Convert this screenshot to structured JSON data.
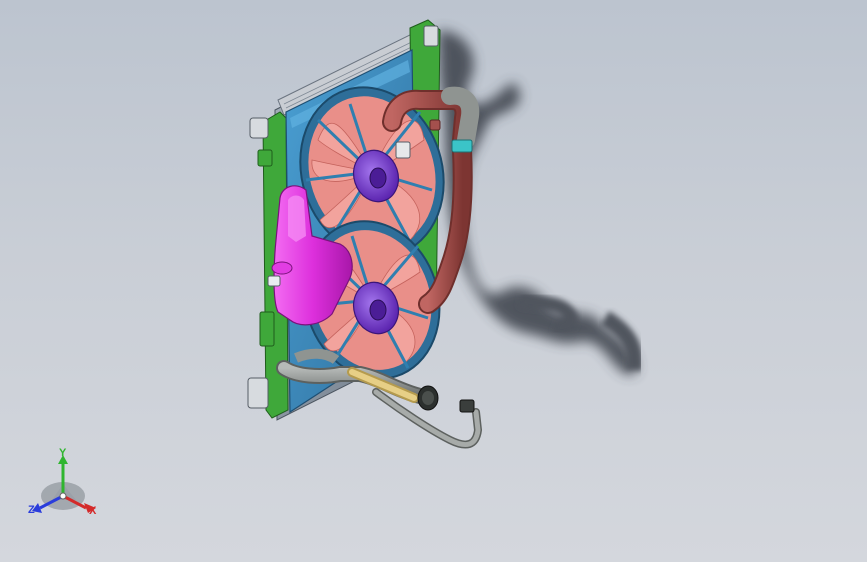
{
  "viewport": {
    "background_top": "#bcc4cf",
    "background_bottom": "#d4d7dd"
  },
  "model": {
    "colors": {
      "radiator_core": "#8d99a6",
      "fan_shroud": "#3f8fc4",
      "side_brackets": "#3fa83a",
      "fan_blades": "#f07e79",
      "fan_motor_hub": "#7b3fd6",
      "expansion_tank": "#e23de3",
      "upper_hose": "#a4504d",
      "lower_hose": "#8a8e8c",
      "hose_sleeve": "#e7cf86",
      "hose_clamp": "#3bc4c8",
      "shadow": "#333841"
    },
    "components": [
      "radiator-core",
      "fan-shroud",
      "upper-fan",
      "lower-fan",
      "expansion-tank",
      "upper-hose",
      "lower-hose",
      "side-brackets"
    ]
  },
  "triad": {
    "y_label": "Y",
    "z_label": "Z",
    "x_label": "X",
    "colors": {
      "y": "#2fb52f",
      "z": "#2a3ddc",
      "x": "#d42a2a"
    }
  }
}
